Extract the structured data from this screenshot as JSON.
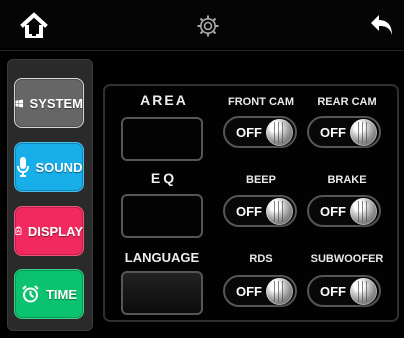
{
  "top_bar": {
    "home_icon": "home-icon",
    "settings_icon": "gear-icon",
    "back_icon": "back-arrow-icon"
  },
  "sidebar": {
    "items": [
      {
        "id": "system",
        "label": "SYSTEM",
        "icon": "windows-icon",
        "color": "#666666"
      },
      {
        "id": "sound",
        "label": "SOUND",
        "icon": "microphone-icon",
        "color": "#17AEEA"
      },
      {
        "id": "display",
        "label": "DISPLAY",
        "icon": "display-icon",
        "color": "#F2295F"
      },
      {
        "id": "time",
        "label": "TIME",
        "icon": "alarm-clock-icon",
        "color": "#0BC36E"
      }
    ]
  },
  "settings": {
    "area_label": "AREA",
    "eq_label": "EQ",
    "language_label": "LANGUAGE",
    "toggles": [
      {
        "id": "front_cam",
        "label": "FRONT CAM",
        "state": "OFF"
      },
      {
        "id": "rear_cam",
        "label": "REAR CAM",
        "state": "OFF"
      },
      {
        "id": "beep",
        "label": "BEEP",
        "state": "OFF"
      },
      {
        "id": "brake",
        "label": "BRAKE",
        "state": "OFF"
      },
      {
        "id": "rds",
        "label": "RDS",
        "state": "OFF"
      },
      {
        "id": "subwoofer",
        "label": "SUBWOOFER",
        "state": "OFF"
      }
    ]
  }
}
